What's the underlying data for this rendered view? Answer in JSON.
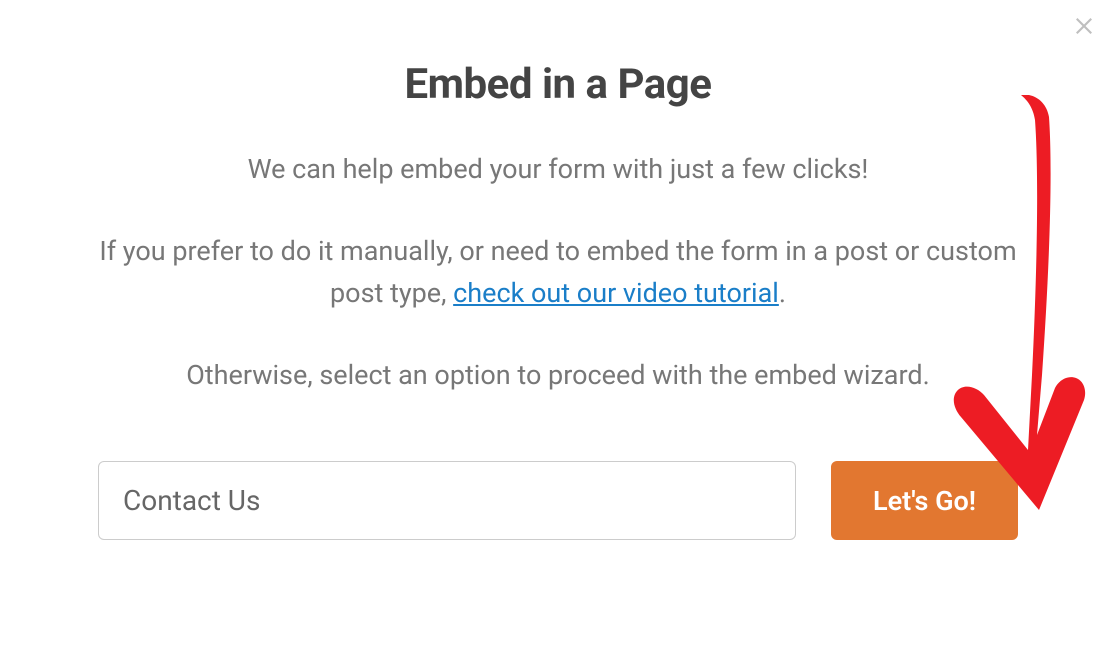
{
  "modal": {
    "title": "Embed in a Page",
    "description": {
      "line1": "We can help embed your form with just a few clicks!",
      "line2a": "If you prefer to do it manually, or need to embed the form in a post or custom post type, ",
      "link": "check out our video tutorial",
      "line2b": ".",
      "line3": "Otherwise, select an option to proceed with the embed wizard."
    },
    "input": {
      "value": "Contact Us"
    },
    "button": {
      "label": "Let's Go!"
    }
  }
}
